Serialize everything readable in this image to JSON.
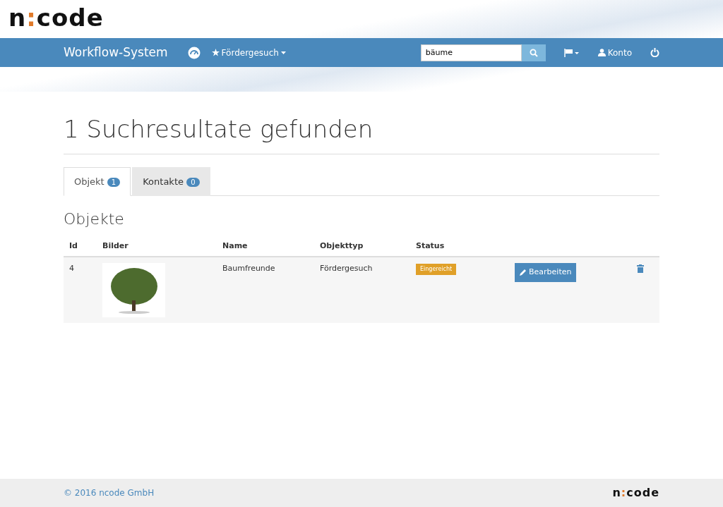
{
  "logo": {
    "prefix": "n",
    "separator": ":",
    "suffix": "code"
  },
  "navbar": {
    "brand": "Workflow-System",
    "menu": "Fördergesuch",
    "search": {
      "value": "bäume"
    },
    "account": "Konto"
  },
  "heading": "1 Suchresultate gefunden",
  "tabs": [
    {
      "label": "Objekt",
      "count": "1",
      "selected": true
    },
    {
      "label": "Kontakte",
      "count": "0",
      "selected": false
    }
  ],
  "section_title": "Objekte",
  "table": {
    "columns": [
      "Id",
      "Bilder",
      "Name",
      "Objekttyp",
      "Status"
    ],
    "rows": [
      {
        "id": "4",
        "name": "Baumfreunde",
        "type": "Fördergesuch",
        "status": "Eingereicht",
        "edit": "Bearbeiten"
      }
    ]
  },
  "footer": {
    "copyright": "© 2016 ncode GmbH",
    "logo": {
      "prefix": "n",
      "separator": ":",
      "suffix": "code"
    }
  }
}
